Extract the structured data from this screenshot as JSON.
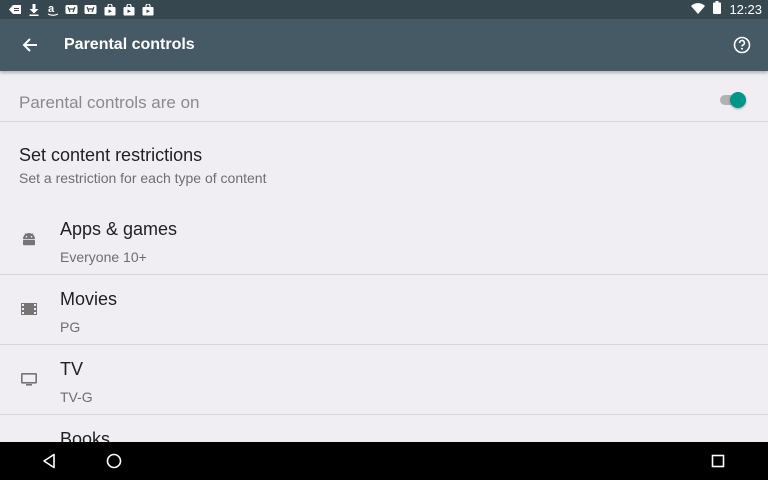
{
  "status_bar": {
    "time": "12:23",
    "left_icons": [
      "notification-icon",
      "download-icon",
      "amazon-icon",
      "gamepad-icon",
      "gamepad-icon",
      "shop-icon",
      "shop-icon",
      "shop-icon"
    ],
    "right_icons": [
      "wifi-icon",
      "battery-icon"
    ]
  },
  "app_bar": {
    "title": "Parental controls",
    "back_icon": "arrow-back-icon",
    "help_icon": "help-icon"
  },
  "master_switch": {
    "label": "Parental controls are on",
    "enabled": true,
    "accent": "#009688"
  },
  "section": {
    "title": "Set content restrictions",
    "subtitle": "Set a restriction for each type of content"
  },
  "items": [
    {
      "title": "Apps & games",
      "subtitle": "Everyone 10+",
      "icon": "android-icon"
    },
    {
      "title": "Movies",
      "subtitle": "PG",
      "icon": "film-icon"
    },
    {
      "title": "TV",
      "subtitle": "TV-G",
      "icon": "tv-icon"
    },
    {
      "title": "Books",
      "subtitle": "",
      "icon": ""
    }
  ],
  "nav_bar": {
    "back_icon": "nav-back-icon",
    "home_icon": "nav-home-icon",
    "recents_icon": "nav-recents-icon"
  },
  "colors": {
    "app_bar": "#455a64",
    "status_bar": "#37474f",
    "background": "#f0eef2"
  }
}
